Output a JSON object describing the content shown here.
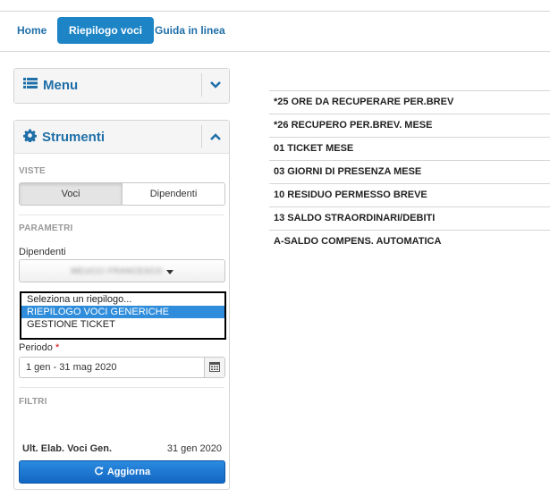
{
  "nav": {
    "tabs": [
      {
        "label": "Home",
        "active": false
      },
      {
        "label": "Riepilogo voci",
        "active": true
      },
      {
        "label": "Guida in linea",
        "active": false
      }
    ]
  },
  "menu_panel": {
    "title": "Menu",
    "icon": "list-icon",
    "toggle_icon": "chevron-down-icon"
  },
  "tools_panel": {
    "title": "Strumenti",
    "icon": "gear-icon",
    "toggle_icon": "chevron-up-icon",
    "viste": {
      "label": "VISTE",
      "options": [
        "Voci",
        "Dipendenti"
      ],
      "selected": "Voci"
    },
    "parametri": {
      "label": "PARAMETRI",
      "dipendenti_label": "Dipendenti",
      "dipendente_value": "MEUCCI FRANCESCO",
      "riepilogo_options": [
        "Seleziona un riepilogo...",
        "RIEPILOGO VOCI GENERICHE",
        "GESTIONE TICKET"
      ],
      "riepilogo_selected": "RIEPILOGO VOCI GENERICHE",
      "periodo_label": "Periodo",
      "required_mark": "*",
      "periodo_value": "1 gen - 31 mag 2020"
    },
    "filtri": {
      "label": "FILTRI"
    },
    "ult_elab_label": "Ult. Elab. Voci Gen.",
    "ult_elab_value": "31 gen 2020",
    "refresh_label": "Aggiorna"
  },
  "voci": [
    "*25 ORE DA RECUPERARE PER.BREV",
    "*26 RECUPERO PER.BREV. MESE",
    "01 TICKET MESE",
    "03 GIORNI DI PRESENZA MESE",
    "10 RESIDUO PERMESSO BREVE",
    "13 SALDO STRAORDINARI/DEBITI",
    "A-SALDO COMPENS. AUTOMATICA"
  ],
  "colors": {
    "accent": "#1d85c6",
    "link": "#1f6fa8",
    "selection": "#2f8ddb",
    "button": "#1266c2"
  }
}
